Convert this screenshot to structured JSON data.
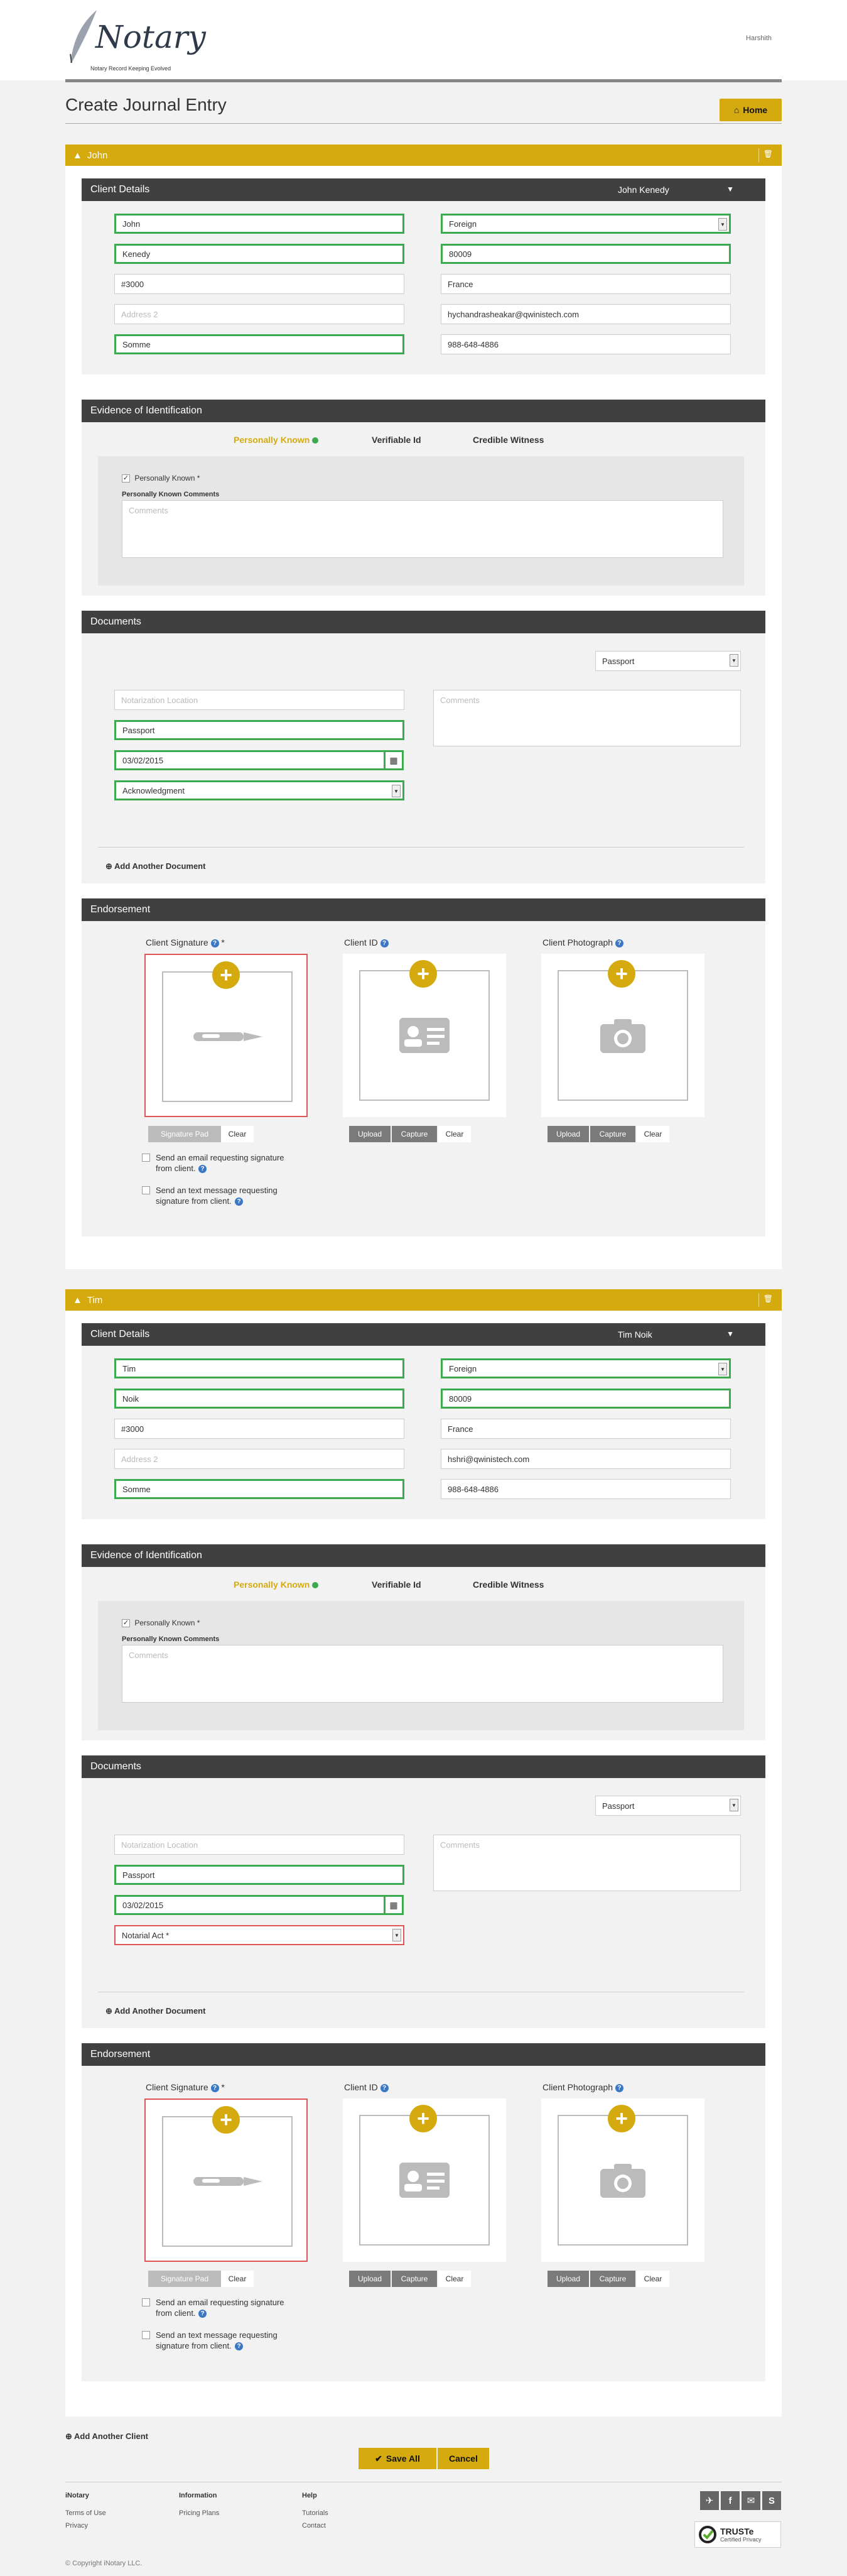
{
  "header": {
    "logo_text": "Notary",
    "logo_tagline": "Notary Record Keeping Evolved",
    "user_name": "Harshith"
  },
  "page": {
    "title": "Create Journal Entry",
    "home_label": "Home"
  },
  "clients": [
    {
      "name": "John",
      "details_title": "Client Details",
      "details_name": "John Kenedy",
      "first_name": "John",
      "last_name": "Kenedy",
      "address1": "#3000",
      "address2_placeholder": "Address 2",
      "city": "Somme",
      "country_type": "Foreign",
      "zip": "80009",
      "country": "France",
      "email": "hychandrasheakar@qwinistech.com",
      "phone": "988-648-4886",
      "evidence_title": "Evidence of Identification",
      "evidence_tabs": [
        "Personally Known",
        "Verifiable Id",
        "Credible Witness"
      ],
      "personally_known_label": "Personally Known *",
      "pk_comments_label": "Personally Known Comments",
      "comments_placeholder": "Comments",
      "documents_title": "Documents",
      "doc_type_select": "Passport",
      "notarization_placeholder": "Notarization Location",
      "doc_name": "Passport",
      "doc_date": "03/02/2015",
      "act": "Acknowledgment",
      "act_valid": true,
      "doc_comments_placeholder": "Comments",
      "add_document": "Add Another Document",
      "endorsement_title": "Endorsement",
      "signature_label": "Client Signature",
      "signature_required": "*",
      "client_id_label": "Client ID",
      "client_photo_label": "Client Photograph",
      "sig_pad": "Signature Pad",
      "clear": "Clear",
      "upload": "Upload",
      "capture": "Capture",
      "email_request": "Send an email requesting signature from client.",
      "text_request": "Send an text message requesting signature from client."
    },
    {
      "name": "Tim",
      "details_title": "Client Details",
      "details_name": "Tim Noik",
      "first_name": "Tim",
      "last_name": "Noik",
      "address1": "#3000",
      "address2_placeholder": "Address 2",
      "city": "Somme",
      "country_type": "Foreign",
      "zip": "80009",
      "country": "France",
      "email": "hshri@qwinistech.com",
      "phone": "988-648-4886",
      "evidence_title": "Evidence of Identification",
      "evidence_tabs": [
        "Personally Known",
        "Verifiable Id",
        "Credible Witness"
      ],
      "personally_known_label": "Personally Known *",
      "pk_comments_label": "Personally Known Comments",
      "comments_placeholder": "Comments",
      "documents_title": "Documents",
      "doc_type_select": "Passport",
      "notarization_placeholder": "Notarization Location",
      "doc_name": "Passport",
      "doc_date": "03/02/2015",
      "act": "Notarial Act *",
      "act_valid": false,
      "doc_comments_placeholder": "Comments",
      "add_document": "Add Another Document",
      "endorsement_title": "Endorsement",
      "signature_label": "Client Signature",
      "signature_required": "*",
      "client_id_label": "Client ID",
      "client_photo_label": "Client Photograph",
      "sig_pad": "Signature Pad",
      "clear": "Clear",
      "upload": "Upload",
      "capture": "Capture",
      "email_request": "Send an email requesting signature from client.",
      "text_request": "Send an text message requesting signature from client."
    }
  ],
  "actions": {
    "add_client": "Add Another Client",
    "save_all": "Save All",
    "cancel": "Cancel"
  },
  "footer": {
    "col1_title": "iNotary",
    "col1_items": [
      "Terms of Use",
      "Privacy"
    ],
    "col2_title": "Information",
    "col2_items": [
      "Pricing Plans"
    ],
    "col3_title": "Help",
    "col3_items": [
      "Tutorials",
      "Contact"
    ],
    "truste_title": "TRUSTe",
    "truste_sub": "Certified Privacy",
    "copyright": "© Copyright iNotary LLC."
  },
  "colors": {
    "accent": "#d4aa0f",
    "dark_bar": "#404040",
    "valid": "#3caa4f",
    "invalid": "#e25555"
  }
}
